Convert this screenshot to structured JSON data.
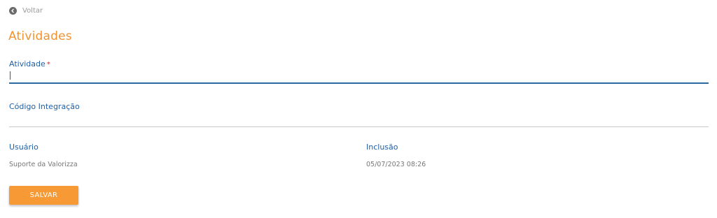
{
  "header": {
    "back_label": "Voltar",
    "back_icon": "arrow-left-circle-icon",
    "title": "Atividades"
  },
  "form": {
    "atividade": {
      "label": "Atividade",
      "required_mark": "*",
      "value": ""
    },
    "codigo_integracao": {
      "label": "Código Integração",
      "value": ""
    }
  },
  "info": {
    "usuario_label": "Usuário",
    "usuario_value": "Suporte da Valorizza",
    "inclusao_label": "Inclusão",
    "inclusao_value": "05/07/2023 08:26"
  },
  "actions": {
    "save_label": "SALVAR"
  },
  "colors": {
    "accent": "#f2922e",
    "button": "#f79a35",
    "label": "#1f5fa5",
    "active_line": "#2b6a9e",
    "required": "#e02424"
  }
}
